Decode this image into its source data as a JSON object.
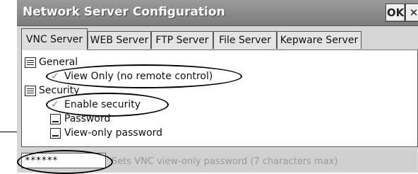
{
  "window": {
    "title": "Network Server Configuration",
    "ok_label": "OK",
    "close_label": "✕"
  },
  "tabs": [
    {
      "label": "VNC Server",
      "active": true
    },
    {
      "label": "WEB Server",
      "active": false
    },
    {
      "label": "FTP Server",
      "active": false
    },
    {
      "label": "File Server",
      "active": false
    },
    {
      "label": "Kepware Server",
      "active": false
    }
  ],
  "tree": {
    "general": {
      "label": "General",
      "icon": "list-icon",
      "items": [
        {
          "label": "View Only (no remote control)",
          "checked": true,
          "icon": "checkbox-icon"
        }
      ]
    },
    "security": {
      "label": "Security",
      "icon": "list-icon",
      "items": [
        {
          "label": "Enable security",
          "checked": true,
          "icon": "checkbox-icon"
        },
        {
          "label": "Password",
          "checked": false,
          "icon": "password-field-icon"
        },
        {
          "label": "View-only password",
          "checked": false,
          "icon": "password-field-icon"
        }
      ]
    }
  },
  "status": {
    "password_value": "******",
    "hint_text": "Sets VNC view-only password (7 characters max)"
  }
}
